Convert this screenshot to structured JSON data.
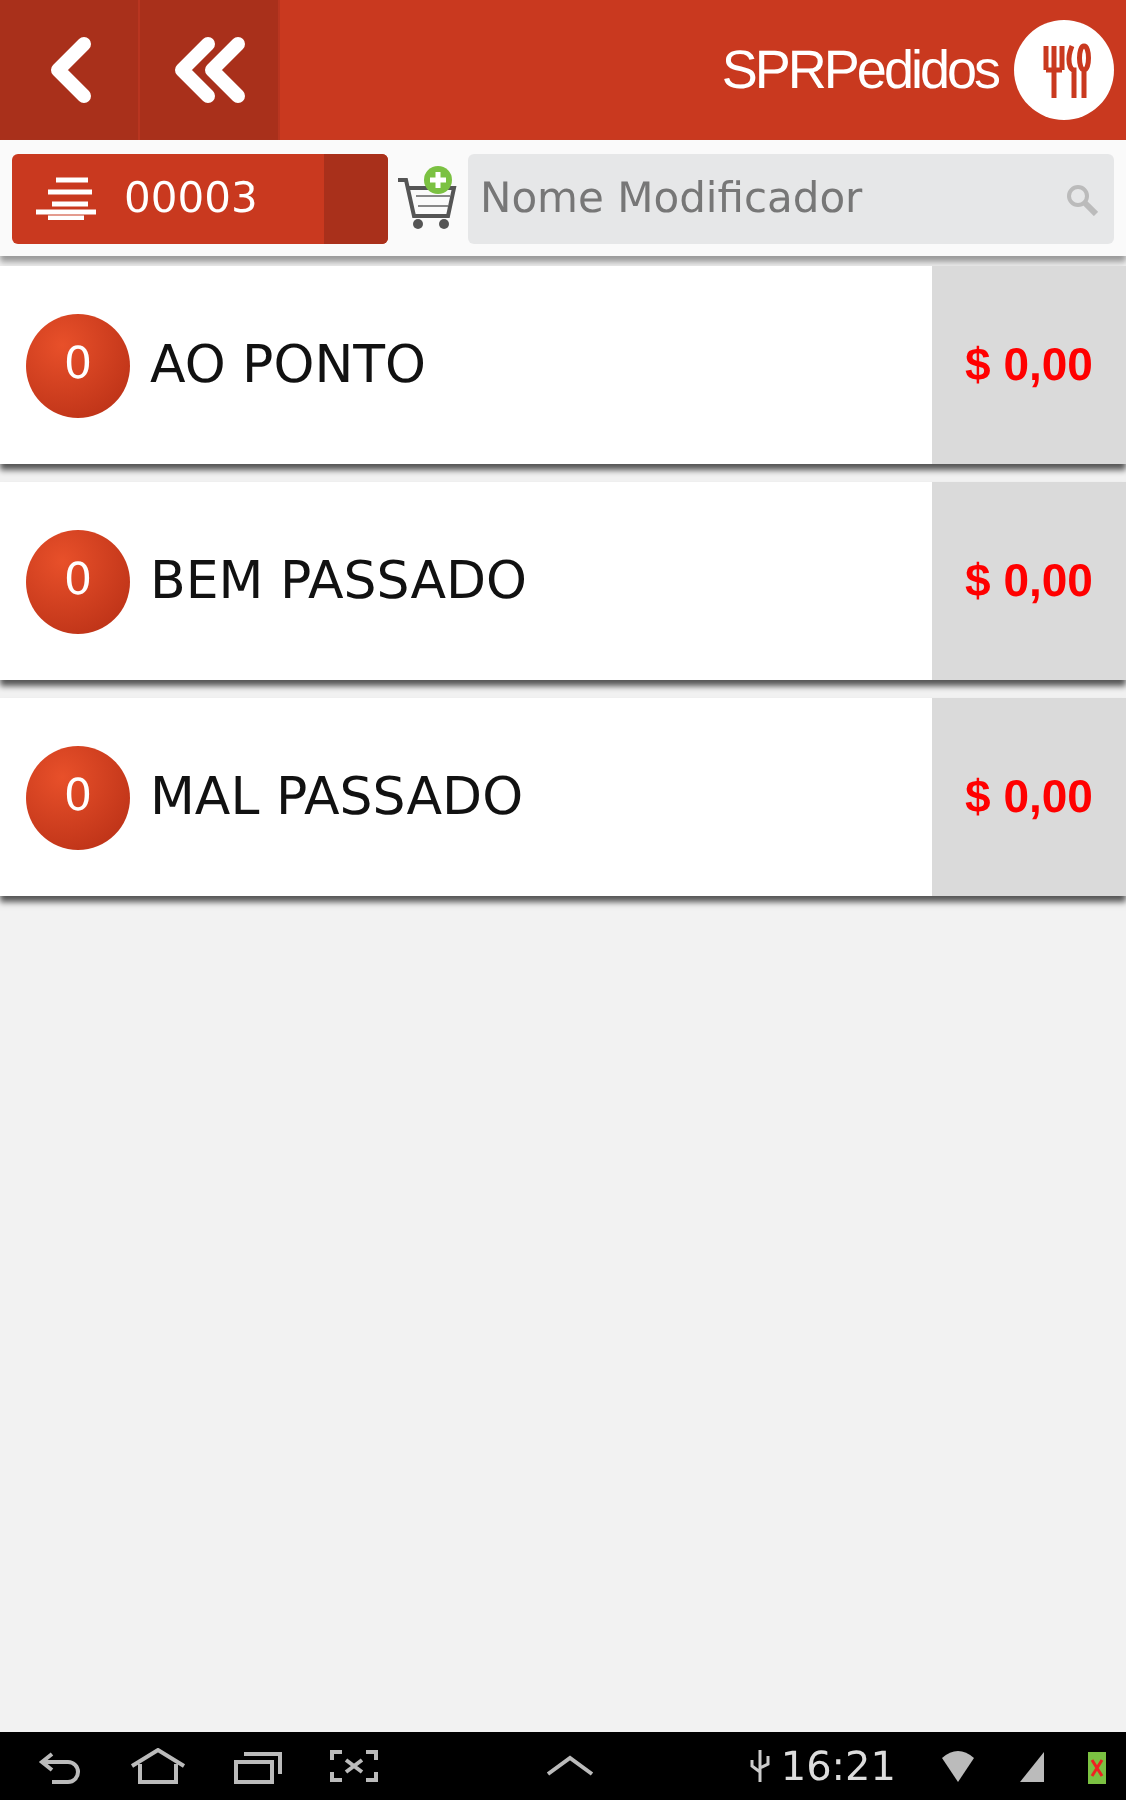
{
  "header": {
    "app_name": "SPRPedidos"
  },
  "toolbar": {
    "order_number": "00003",
    "search": {
      "placeholder": "Nome Modificador"
    }
  },
  "items": [
    {
      "quantity": "0",
      "name": "AO PONTO",
      "price": "$ 0,00"
    },
    {
      "quantity": "0",
      "name": "BEM PASSADO",
      "price": "$ 0,00"
    },
    {
      "quantity": "0",
      "name": "MAL PASSADO",
      "price": "$ 0,00"
    }
  ],
  "status_bar": {
    "time": "16:21"
  }
}
